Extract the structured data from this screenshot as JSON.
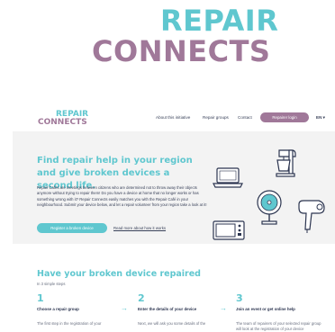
{
  "brand": {
    "line1": "REPAIR",
    "line2": "CONNECTS"
  },
  "nav": {
    "logo_line1": "REPAIR",
    "logo_line2": "CONNECTS",
    "links": [
      "About this initiative",
      "Repair groups",
      "Contact"
    ],
    "register_label": "Repairer login",
    "language": "EN ▾"
  },
  "hero": {
    "title": "Find repair help in your region and give broken devices a second life.",
    "intro": "Repair Cafés are meetings between citizens who are determined not to throw away their objects anymore without trying to repair them! Do you have a device at home that no longer works or has something wrong with it? Repair Connects easily matches you with the Repair Café in your neighbourhood. Submit your device below, and let a repair volunteer from your region take a look at it!",
    "cta_label": "Register a broken device",
    "more_label": "Read more about how it works",
    "illustration_icons": [
      "laptop-icon",
      "stand-mixer-icon",
      "fan-icon",
      "hair-dryer-icon",
      "microwave-icon"
    ]
  },
  "steps_section": {
    "title": "Have your broken device repaired",
    "subtitle": "In 3 simple steps",
    "steps": [
      {
        "num": "1",
        "title": "Choose a repair group",
        "desc": "The first step in the registration of your"
      },
      {
        "num": "2",
        "title": "Enter the details of your device",
        "desc": "Next, we will ask you some details of the"
      },
      {
        "num": "3",
        "title": "Join an event or get online help",
        "desc": "The team of repairers of your selected repair group will look at the registration of your device"
      }
    ]
  },
  "colors": {
    "teal": "#5fc7cf",
    "mauve": "#a07899",
    "hero_bg": "#f3f3f3"
  }
}
